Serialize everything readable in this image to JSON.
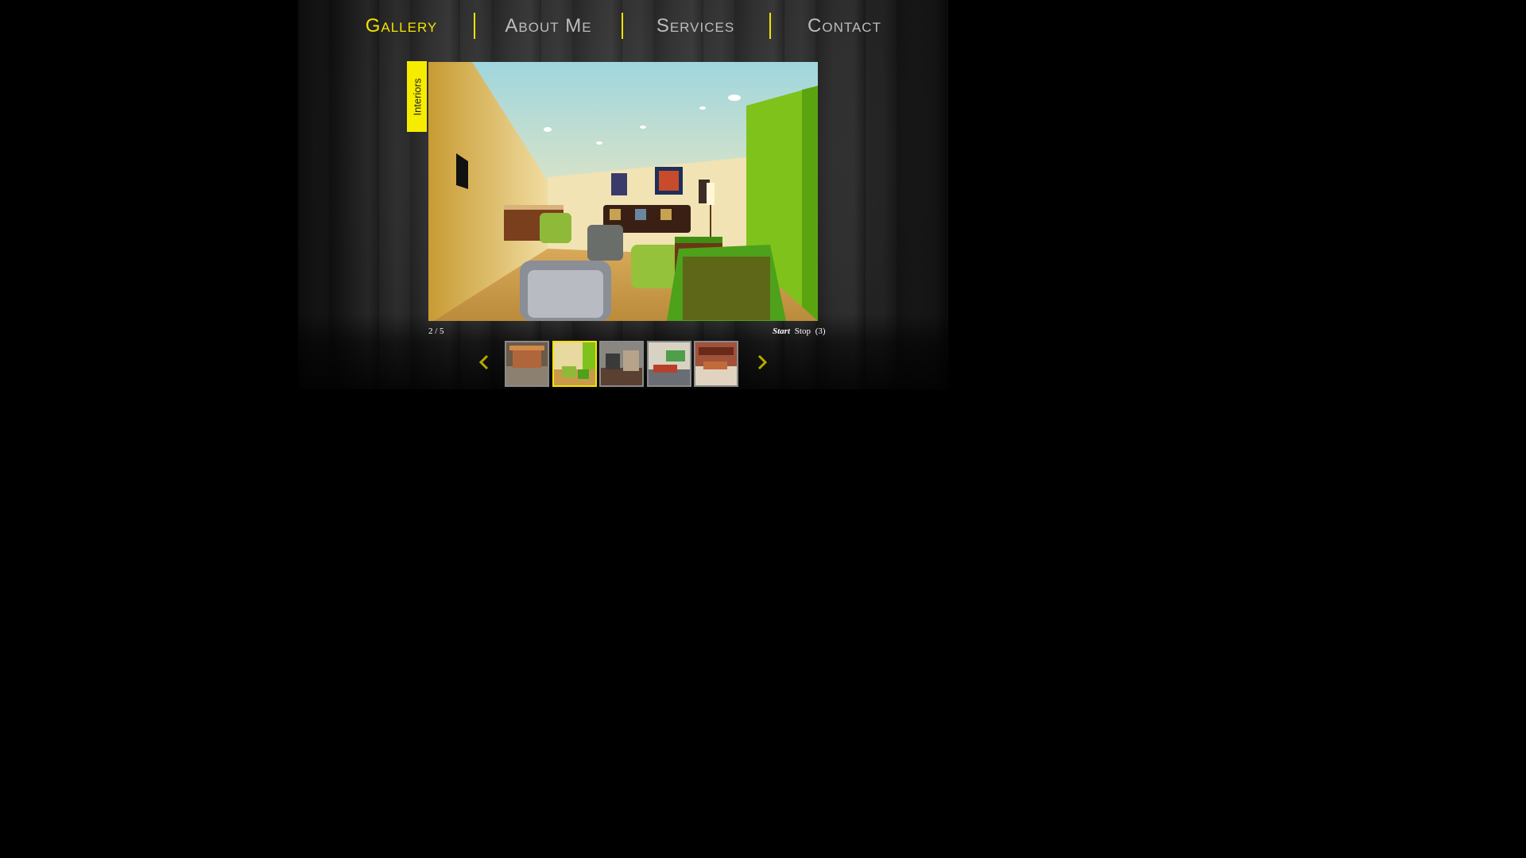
{
  "nav": {
    "items": [
      {
        "label": "Gallery"
      },
      {
        "label": "About Me"
      },
      {
        "label": "Services"
      },
      {
        "label": "Contact"
      }
    ]
  },
  "gallery": {
    "category_tab": "Interiors",
    "counter": "2 / 5",
    "controls": {
      "start": "Start",
      "stop": "Stop",
      "interval": "(3)"
    },
    "current_index": 2,
    "total": 5
  },
  "colors": {
    "accent": "#f3e300",
    "nav_text": "#bdbdbd",
    "background": "#000000"
  },
  "icons": {
    "prev": "chevron-left-icon",
    "next": "chevron-right-icon"
  }
}
